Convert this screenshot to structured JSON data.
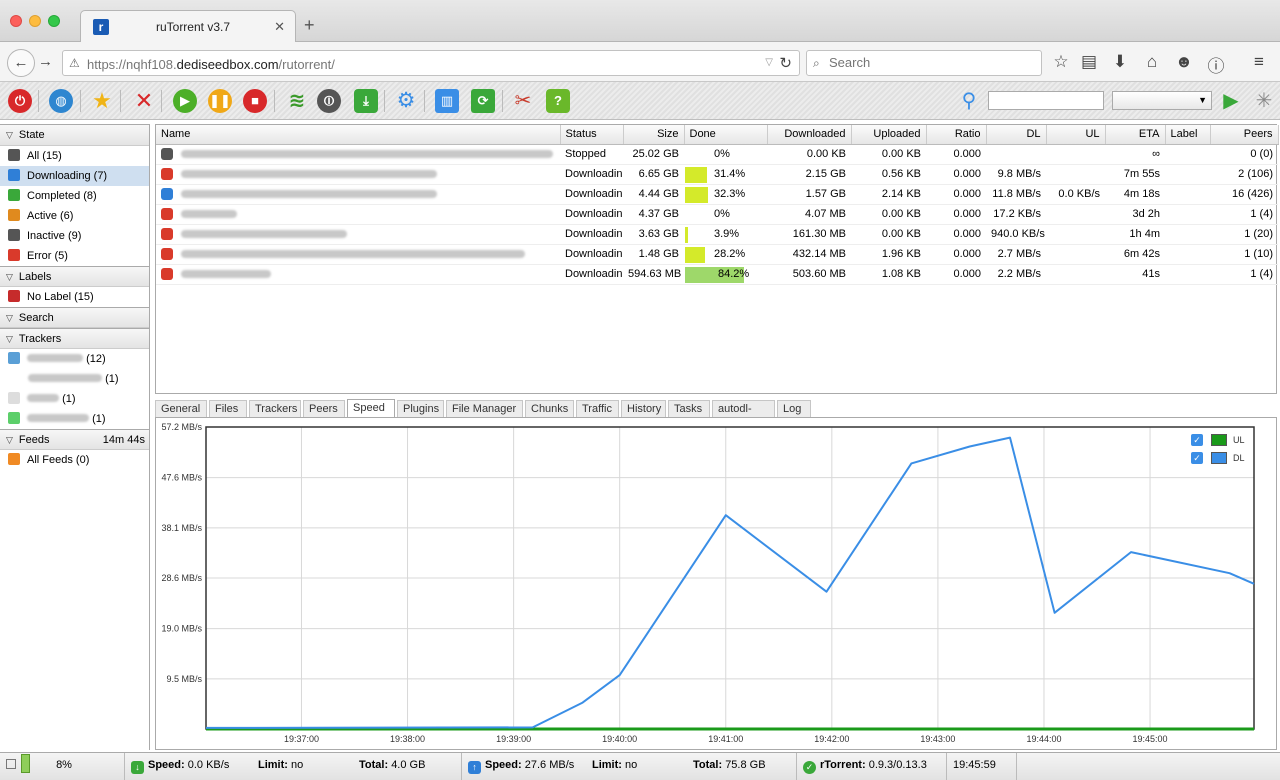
{
  "browser": {
    "tab_title": "ruTorrent v3.7",
    "url_host_prefix": "https://nqhf108.",
    "url_host": "dediseedbox.com",
    "url_path": "/rutorrent/",
    "search_placeholder": "Search"
  },
  "sidebar": {
    "state_header": "State",
    "state_items": [
      {
        "label": "All (15)",
        "icon": "all-icon",
        "color": "#555555"
      },
      {
        "label": "Downloading (7)",
        "icon": "downloading-icon",
        "color": "#2f7fd7",
        "selected": true
      },
      {
        "label": "Completed (8)",
        "icon": "completed-icon",
        "color": "#3aa83a"
      },
      {
        "label": "Active (6)",
        "icon": "active-icon",
        "color": "#e08a1e"
      },
      {
        "label": "Inactive (9)",
        "icon": "inactive-icon",
        "color": "#555555"
      },
      {
        "label": "Error (5)",
        "icon": "error-icon",
        "color": "#d93a2b"
      }
    ],
    "labels_header": "Labels",
    "label_items": [
      {
        "label": "No Label (15)",
        "icon": "no-label-icon",
        "color": "#c62b2b"
      }
    ],
    "search_header": "Search",
    "trackers_header": "Trackers",
    "tracker_counts": [
      "(12)",
      "(1)",
      "(1)",
      "(1)"
    ],
    "feeds_header": "Feeds",
    "feeds_time": "14m 44s",
    "feed_items": [
      {
        "label": "All Feeds (0)",
        "icon": "rss-icon",
        "color": "#f08a24"
      }
    ]
  },
  "table": {
    "columns": [
      "Name",
      "Status",
      "Size",
      "Done",
      "Downloaded",
      "Uploaded",
      "Ratio",
      "DL",
      "UL",
      "ETA",
      "Label",
      "Peers"
    ],
    "rows": [
      {
        "status": "Stopped",
        "size": "25.02 GB",
        "done": "0%",
        "done_pct": 0,
        "downloaded": "0.00 KB",
        "uploaded": "0.00 KB",
        "ratio": "0.000",
        "dl": "",
        "ul": "",
        "eta": "∞",
        "label": "",
        "peers": "0 (0)",
        "icon_color": "#555555"
      },
      {
        "status": "Downloadin",
        "size": "6.65 GB",
        "done": "31.4%",
        "done_pct": 31.4,
        "downloaded": "2.15 GB",
        "uploaded": "0.56 KB",
        "ratio": "0.000",
        "dl": "9.8 MB/s",
        "ul": "",
        "eta": "7m 55s",
        "label": "",
        "peers": "2 (106)",
        "icon_color": "#d93a2b"
      },
      {
        "status": "Downloadin",
        "size": "4.44 GB",
        "done": "32.3%",
        "done_pct": 32.3,
        "downloaded": "1.57 GB",
        "uploaded": "2.14 KB",
        "ratio": "0.000",
        "dl": "11.8 MB/s",
        "ul": "0.0 KB/s",
        "eta": "4m 18s",
        "label": "",
        "peers": "16 (426)",
        "icon_color": "#2f7fd7"
      },
      {
        "status": "Downloadin",
        "size": "4.37 GB",
        "done": "0%",
        "done_pct": 0,
        "downloaded": "4.07 MB",
        "uploaded": "0.00 KB",
        "ratio": "0.000",
        "dl": "17.2 KB/s",
        "ul": "",
        "eta": "3d 2h",
        "label": "",
        "peers": "1 (4)",
        "icon_color": "#d93a2b"
      },
      {
        "status": "Downloadin",
        "size": "3.63 GB",
        "done": "3.9%",
        "done_pct": 3.9,
        "downloaded": "161.30 MB",
        "uploaded": "0.00 KB",
        "ratio": "0.000",
        "dl": "940.0 KB/s",
        "ul": "",
        "eta": "1h 4m",
        "label": "",
        "peers": "1 (20)",
        "icon_color": "#d93a2b"
      },
      {
        "status": "Downloadin",
        "size": "1.48 GB",
        "done": "28.2%",
        "done_pct": 28.2,
        "downloaded": "432.14 MB",
        "uploaded": "1.96 KB",
        "ratio": "0.000",
        "dl": "2.7 MB/s",
        "ul": "",
        "eta": "6m 42s",
        "label": "",
        "peers": "1 (10)",
        "icon_color": "#d93a2b"
      },
      {
        "status": "Downloadin",
        "size": "594.63 MB",
        "done": "84.2%",
        "done_pct": 84.2,
        "downloaded": "503.60 MB",
        "uploaded": "1.08 KB",
        "ratio": "0.000",
        "dl": "2.2 MB/s",
        "ul": "",
        "eta": "41s",
        "label": "",
        "peers": "1 (4)",
        "icon_color": "#d93a2b"
      }
    ]
  },
  "tabs": [
    "General",
    "Files",
    "Trackers",
    "Peers",
    "Speed",
    "Plugins",
    "File Manager",
    "Chunks",
    "Traffic",
    "History",
    "Tasks",
    "autodl-irssi",
    "Log"
  ],
  "active_tab": "Speed",
  "chart_data": {
    "type": "line",
    "y_ticks": [
      "9.5 MB/s",
      "19.0 MB/s",
      "28.6 MB/s",
      "38.1 MB/s",
      "47.6 MB/s",
      "57.2 MB/s"
    ],
    "y_tick_values": [
      9.5,
      19.0,
      28.6,
      38.1,
      47.6,
      57.2
    ],
    "ylim": [
      0,
      57.2
    ],
    "x_ticks": [
      "19:37:00",
      "19:38:00",
      "19:39:00",
      "19:40:00",
      "19:41:00",
      "19:42:00",
      "19:43:00",
      "19:44:00",
      "19:45:00"
    ],
    "x_tick_minutes": [
      37,
      38,
      39,
      40,
      41,
      42,
      43,
      44,
      45
    ],
    "xlim": [
      36.1,
      45.98
    ],
    "grid": true,
    "legend_position": "top-right",
    "series": [
      {
        "name": "UL",
        "color": "#1a9a1a",
        "x": [
          36.1,
          45.98
        ],
        "y": [
          0.0,
          0.0
        ]
      },
      {
        "name": "DL",
        "color": "#3a8ee6",
        "x": [
          36.1,
          39.18,
          39.65,
          40.0,
          41.0,
          41.95,
          42.75,
          43.3,
          43.68,
          44.1,
          44.82,
          45.75,
          45.98
        ],
        "y": [
          0.2,
          0.3,
          5.0,
          10.2,
          40.5,
          26.0,
          50.3,
          53.5,
          55.2,
          22.0,
          33.5,
          29.5,
          27.5
        ]
      }
    ]
  },
  "statusbar": {
    "disk": "8%",
    "dl_speed_label": "Speed:",
    "dl_speed": "0.0 KB/s",
    "dl_limit_label": "Limit:",
    "dl_limit": "no",
    "dl_total_label": "Total:",
    "dl_total": "4.0 GB",
    "ul_speed_label": "Speed:",
    "ul_speed": "27.6 MB/s",
    "ul_limit_label": "Limit:",
    "ul_limit": "no",
    "ul_total_label": "Total:",
    "ul_total": "75.8 GB",
    "version_label": "rTorrent:",
    "version": "0.9.3/0.13.3",
    "clock": "19:45:59"
  }
}
